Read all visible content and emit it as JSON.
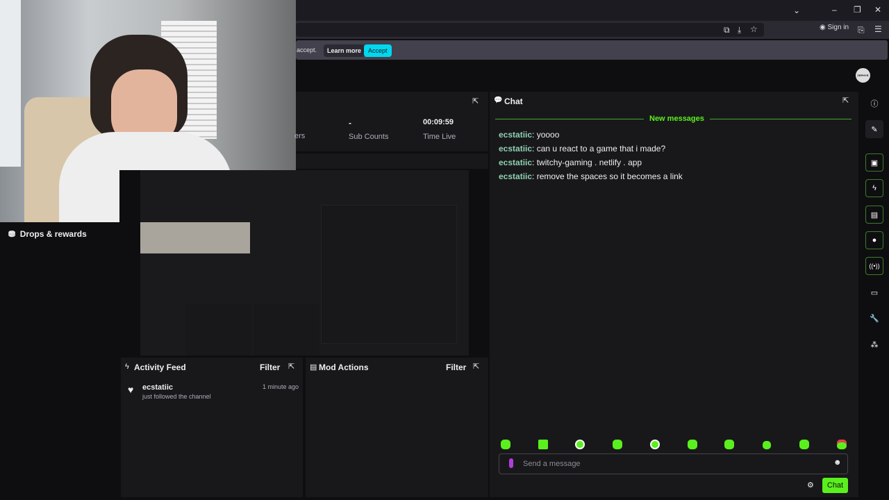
{
  "browser": {
    "signin": "Sign in",
    "notification_tail": "accept.",
    "learn_more": "Learn more",
    "accept": "Accept"
  },
  "site": {
    "avatar_text": "ZEPHYR"
  },
  "sidebar": {
    "drops": "Drops & rewards"
  },
  "stats": {
    "items": [
      {
        "value": "",
        "label": "ers"
      },
      {
        "value": "-",
        "label": "Sub Counts"
      },
      {
        "value": "00:09:59",
        "label": "Time Live"
      }
    ]
  },
  "chat": {
    "title": "Chat",
    "divider": "New messages",
    "messages": [
      {
        "user": "ecstatiic",
        "text": "yoooo"
      },
      {
        "user": "ecstatiic",
        "text": "can u react to a game that i made?"
      },
      {
        "user": "ecstatiic",
        "text": "twitchy-gaming . netlify . app"
      },
      {
        "user": "ecstatiic",
        "text": "remove the spaces so it becomes a link"
      }
    ],
    "placeholder": "Send a message",
    "send": "Chat"
  },
  "activity": {
    "title": "Activity Feed",
    "filter": "Filter",
    "items": [
      {
        "user": "ecstatiic",
        "action": "just followed the channel",
        "time": "1 minute ago"
      }
    ]
  },
  "mod": {
    "title": "Mod Actions",
    "filter": "Filter"
  },
  "rail_icons": [
    "info-icon",
    "pencil-icon",
    "camera-focus-icon",
    "lightning-icon",
    "notes-icon",
    "chat-icon",
    "broadcast-icon",
    "camera-switch-icon",
    "wrench-icon",
    "extensions-icon"
  ],
  "colors": {
    "accent": "#5af01d",
    "accept": "#00d8f0",
    "username": "#8fd1b0"
  }
}
